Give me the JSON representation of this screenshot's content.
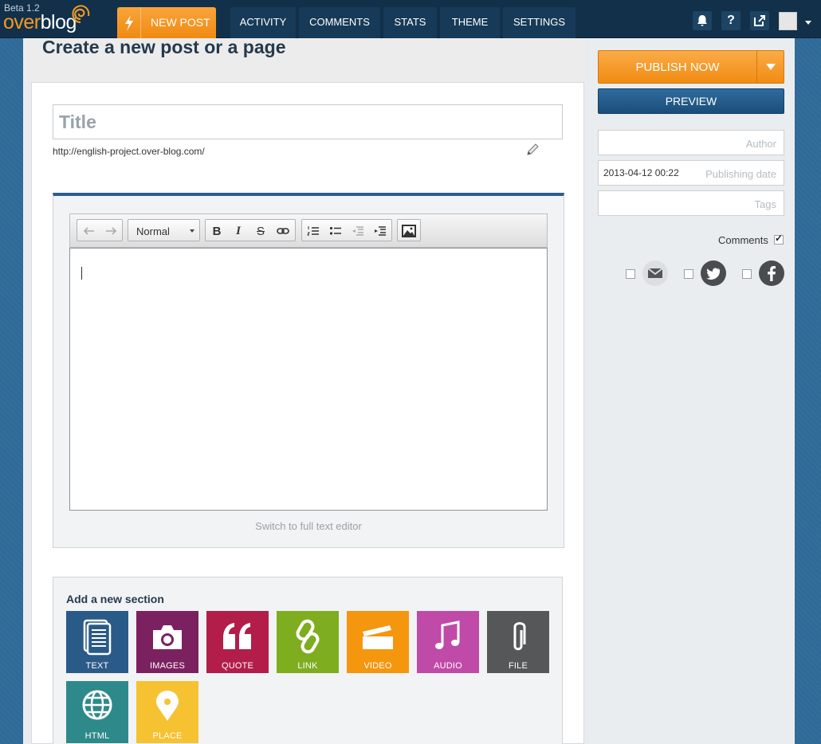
{
  "app": {
    "beta_label": "Beta 1.2",
    "logo_prefix": "over",
    "logo_suffix": "blog"
  },
  "nav": {
    "new_post": "NEW POST",
    "items": [
      {
        "label": "ACTIVITY"
      },
      {
        "label": "COMMENTS"
      },
      {
        "label": "STATS"
      },
      {
        "label": "THEME"
      },
      {
        "label": "SETTINGS"
      }
    ],
    "icons": [
      "bell-icon",
      "help-icon",
      "external-link-icon",
      "avatar",
      "chevron-down-icon"
    ],
    "help_glyph": "?"
  },
  "page": {
    "title": "Create a new post or a page"
  },
  "post": {
    "title_placeholder": "Title",
    "url": "http://english-project.over-blog.com/"
  },
  "editor": {
    "format_value": "Normal",
    "switch_label": "Switch to full text editor",
    "toolbar_icons": [
      "undo-icon",
      "redo-icon",
      "bold-icon",
      "italic-icon",
      "strikethrough-icon",
      "link-icon",
      "numbered-list-icon",
      "bulleted-list-icon",
      "outdent-icon",
      "indent-icon",
      "image-icon"
    ],
    "bold_glyph": "B",
    "italic_glyph": "I",
    "strike_glyph": "S"
  },
  "sections": {
    "title": "Add a new section",
    "tiles": [
      {
        "label": "TEXT",
        "color": "#2a5a88",
        "icon": "document-icon"
      },
      {
        "label": "IMAGES",
        "color": "#7c2160",
        "icon": "camera-icon"
      },
      {
        "label": "QUOTE",
        "color": "#b21d4a",
        "icon": "quote-icon"
      },
      {
        "label": "LINK",
        "color": "#7ead1f",
        "icon": "chain-link-icon"
      },
      {
        "label": "VIDEO",
        "color": "#f5960f",
        "icon": "clapperboard-icon"
      },
      {
        "label": "AUDIO",
        "color": "#c04aa8",
        "icon": "music-note-icon"
      },
      {
        "label": "FILE",
        "color": "#555759",
        "icon": "paperclip-icon"
      },
      {
        "label": "HTML",
        "color": "#2e8a8a",
        "icon": "globe-icon"
      },
      {
        "label": "PLACE",
        "color": "#f6c232",
        "icon": "map-pin-icon"
      }
    ]
  },
  "sidebar": {
    "publish_label": "PUBLISH NOW",
    "preview_label": "PREVIEW",
    "author_placeholder": "Author",
    "date_value": "2013-04-12 00:22",
    "date_placeholder": "Publishing date",
    "tags_placeholder": "Tags",
    "comments_label": "Comments",
    "comments_checked": true,
    "share": [
      "email-icon",
      "twitter-icon",
      "facebook-icon"
    ]
  }
}
